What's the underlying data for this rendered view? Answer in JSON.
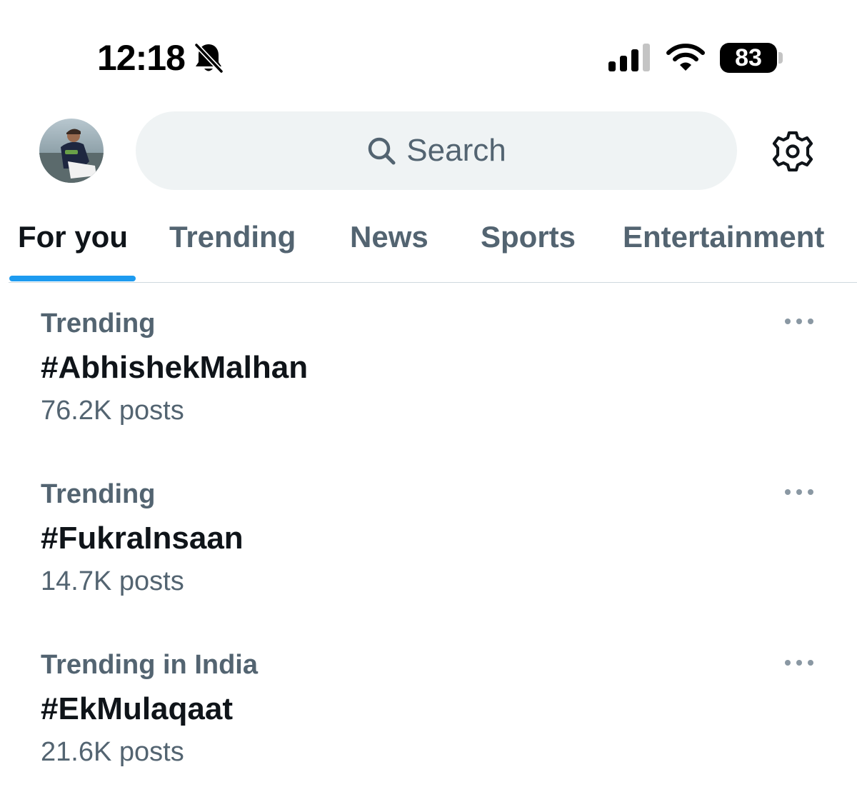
{
  "status_bar": {
    "time": "12:18",
    "battery": "83",
    "icons": [
      "bell-off-icon",
      "cellular-signal-icon",
      "wifi-icon",
      "battery-icon"
    ]
  },
  "header": {
    "search_placeholder": "Search",
    "icons": [
      "search-icon",
      "gear-icon"
    ]
  },
  "tabs": [
    {
      "label": "For you",
      "active": true
    },
    {
      "label": "Trending",
      "active": false
    },
    {
      "label": "News",
      "active": false
    },
    {
      "label": "Sports",
      "active": false
    },
    {
      "label": "Entertainment",
      "active": false
    }
  ],
  "trends": [
    {
      "context": "Trending",
      "name": "#AbhishekMalhan",
      "count": "76.2K posts"
    },
    {
      "context": "Trending",
      "name": "#FukraInsaan",
      "count": "14.7K posts"
    },
    {
      "context": "Trending in India",
      "name": "#EkMulaqaat",
      "count": "21.6K posts"
    }
  ],
  "colors": {
    "accent": "#1d9bf0",
    "text_primary": "#0f1419",
    "text_secondary": "#536471",
    "search_bg": "#eff3f4"
  }
}
